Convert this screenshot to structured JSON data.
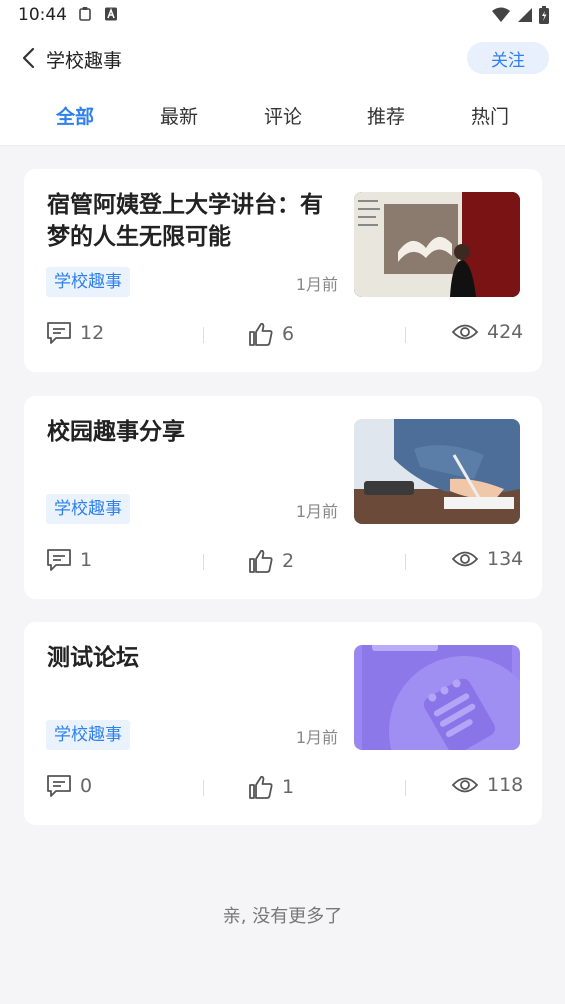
{
  "status_bar": {
    "time": "10:44"
  },
  "nav": {
    "title": "学校趣事",
    "follow_label": "关注"
  },
  "tabs": [
    {
      "label": "全部"
    },
    {
      "label": "最新"
    },
    {
      "label": "评论"
    },
    {
      "label": "推荐"
    },
    {
      "label": "热门"
    }
  ],
  "posts": [
    {
      "title": "宿管阿姨登上大学讲台：有梦的人生无限可能",
      "tag": "学校趣事",
      "date": "1月前",
      "comments": "12",
      "likes": "6",
      "views": "424"
    },
    {
      "title": "校园趣事分享",
      "tag": "学校趣事",
      "date": "1月前",
      "comments": "1",
      "likes": "2",
      "views": "134"
    },
    {
      "title": "测试论坛",
      "tag": "学校趣事",
      "date": "1月前",
      "comments": "0",
      "likes": "1",
      "views": "118"
    }
  ],
  "footer": {
    "text": "亲, 没有更多了"
  },
  "colors": {
    "accent": "#2f80ed",
    "tag_bg": "#eaf3fd",
    "page_bg": "#f5f5f7"
  }
}
